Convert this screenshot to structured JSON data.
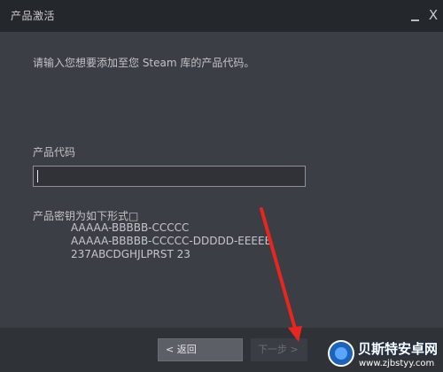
{
  "window": {
    "title": "产品激活",
    "close_glyph": "X"
  },
  "main": {
    "instruction": "请输入您想要添加至您 Steam 库的产品代码。",
    "product_code_label": "产品代码",
    "product_code_value": "",
    "format_label": "产品密钥为如下形式□",
    "format_examples": [
      "AAAAA-BBBBB-CCCCC",
      "AAAAA-BBBBB-CCCCC-DDDDD-EEEEE",
      "237ABCDGHJLPRST 23"
    ]
  },
  "footer": {
    "back_label": "< 返回",
    "next_label": "下一步 >"
  },
  "overlay": {
    "arrow_color": "#e8251e",
    "watermark_name": "贝斯特安卓网",
    "watermark_url": "www.zjbstyy.com"
  }
}
